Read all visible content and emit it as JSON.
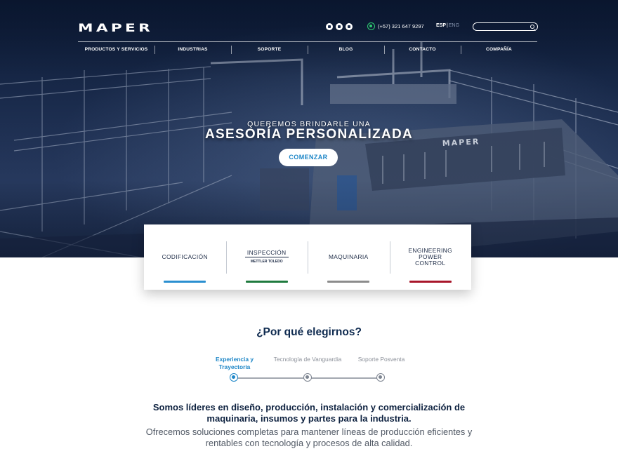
{
  "header": {
    "logo": "MAPER",
    "social": [
      "linkedin-icon",
      "instagram-icon",
      "youtube-icon"
    ],
    "phone": "(+57) 321 647 9297",
    "lang_active": "ESP",
    "lang_sep": "|",
    "lang_other": "ENG",
    "search_placeholder": ""
  },
  "nav": [
    {
      "label": "PRODUCTOS Y SERVICIOS"
    },
    {
      "label": "INDUSTRIAS"
    },
    {
      "label": "SOPORTE"
    },
    {
      "label": "BLOG"
    },
    {
      "label": "CONTACTO"
    },
    {
      "label": "COMPAÑÍA"
    }
  ],
  "hero": {
    "subtitle": "QUEREMOS BRINDARLE UNA",
    "title": "ASESORÍA PERSONALIZADA",
    "cta": "COMENZAR",
    "machine_brand": "MAPER"
  },
  "cards": [
    {
      "label": "CODIFICACIÓN",
      "bar_color": "#2a8fd0"
    },
    {
      "label": "INSPECCIÓN",
      "sublabel": "METTLER TOLEDO",
      "bar_color": "#1f7a3e"
    },
    {
      "label": "MAQUINARIA",
      "bar_color": "#8c8c8c"
    },
    {
      "label": "ENGINEERING POWER CONTROL",
      "bar_color": "#a8162a"
    }
  ],
  "why": {
    "title": "¿Por qué elegirnos?",
    "steps": [
      {
        "label": "Experiencia y Trayectoria",
        "active": true
      },
      {
        "label": "Tecnología de Vanguardia",
        "active": false
      },
      {
        "label": "Soporte Posventa",
        "active": false
      }
    ],
    "lead": "Somos líderes en diseño, producción, instalación y comercialización de maquinaria, insumos y partes para la industria.",
    "body": "Ofrecemos soluciones completas para mantener líneas de producción eficientes y rentables con tecnología y procesos de alta calidad."
  },
  "colors": {
    "accent": "#1d86c7",
    "navy": "#0e2240"
  }
}
